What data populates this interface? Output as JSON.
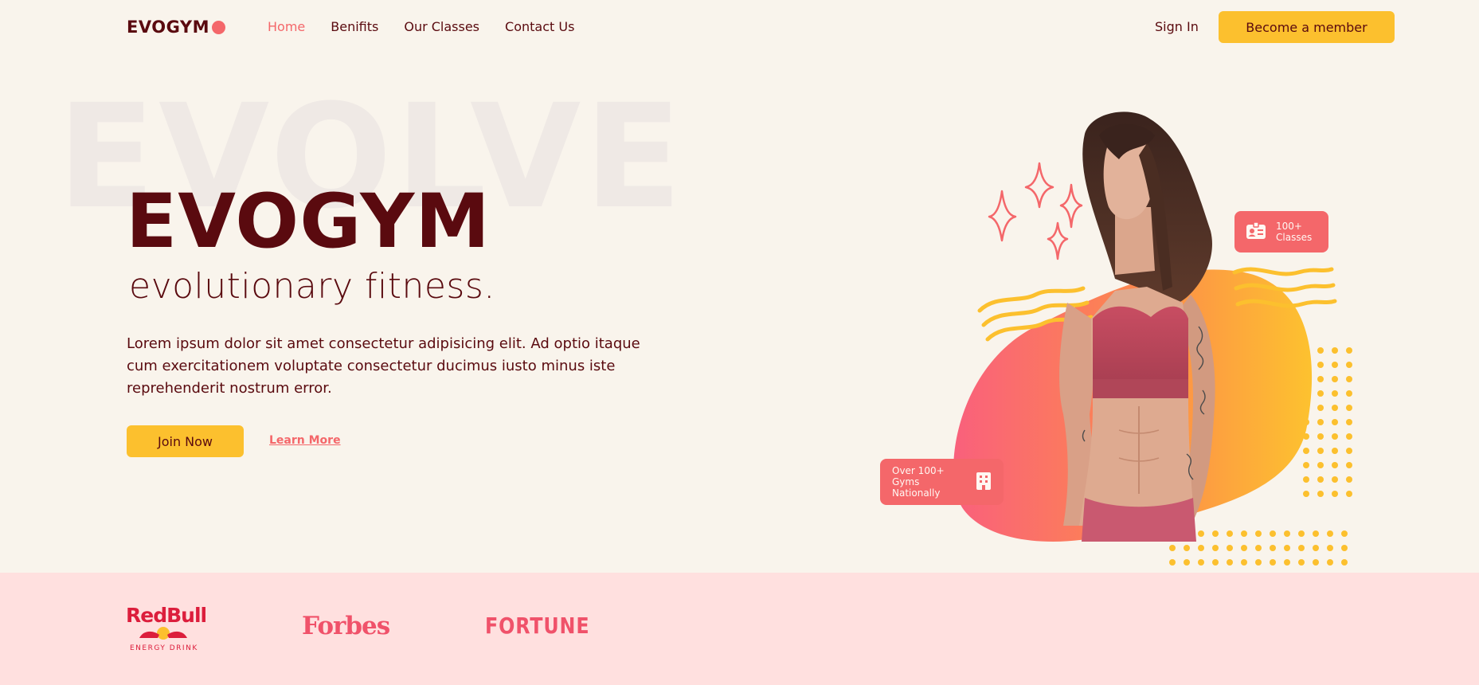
{
  "nav": {
    "logo": "EVOGYM",
    "links": [
      "Home",
      "Benifits",
      "Our Classes",
      "Contact Us"
    ],
    "active_link": "Home",
    "sign_in": "Sign In",
    "member_button": "Become a member"
  },
  "hero": {
    "background_word": "EVOLVE",
    "title": "EVOGYM",
    "subtitle": "evolutionary fitness.",
    "description": "Lorem ipsum dolor sit amet consectetur adipisicing elit. Ad optio itaque cum exercitationem voluptate consectetur ducimus iusto minus iste reprehenderit nostrum error.",
    "join_button": "Join Now",
    "learn_more": "Learn More"
  },
  "badges": {
    "classes_line1": "100+",
    "classes_line2": "Classes",
    "gyms_line1": "Over 100+",
    "gyms_line2": "Gyms Nationally"
  },
  "sponsors": {
    "redbull": "RedBull",
    "redbull_tagline": "ENERGY DRINK",
    "forbes": "Forbes",
    "fortune": "FORTUNE"
  },
  "colors": {
    "background": "#f9f4ec",
    "primary_text": "#5a0a0f",
    "accent_coral": "#f4676a",
    "accent_yellow": "#fcc02e",
    "sponsor_band": "#ffe0df"
  },
  "icons": {
    "logo_dot": "circle",
    "classes_badge": "id-card-icon",
    "gyms_badge": "building-icon"
  }
}
